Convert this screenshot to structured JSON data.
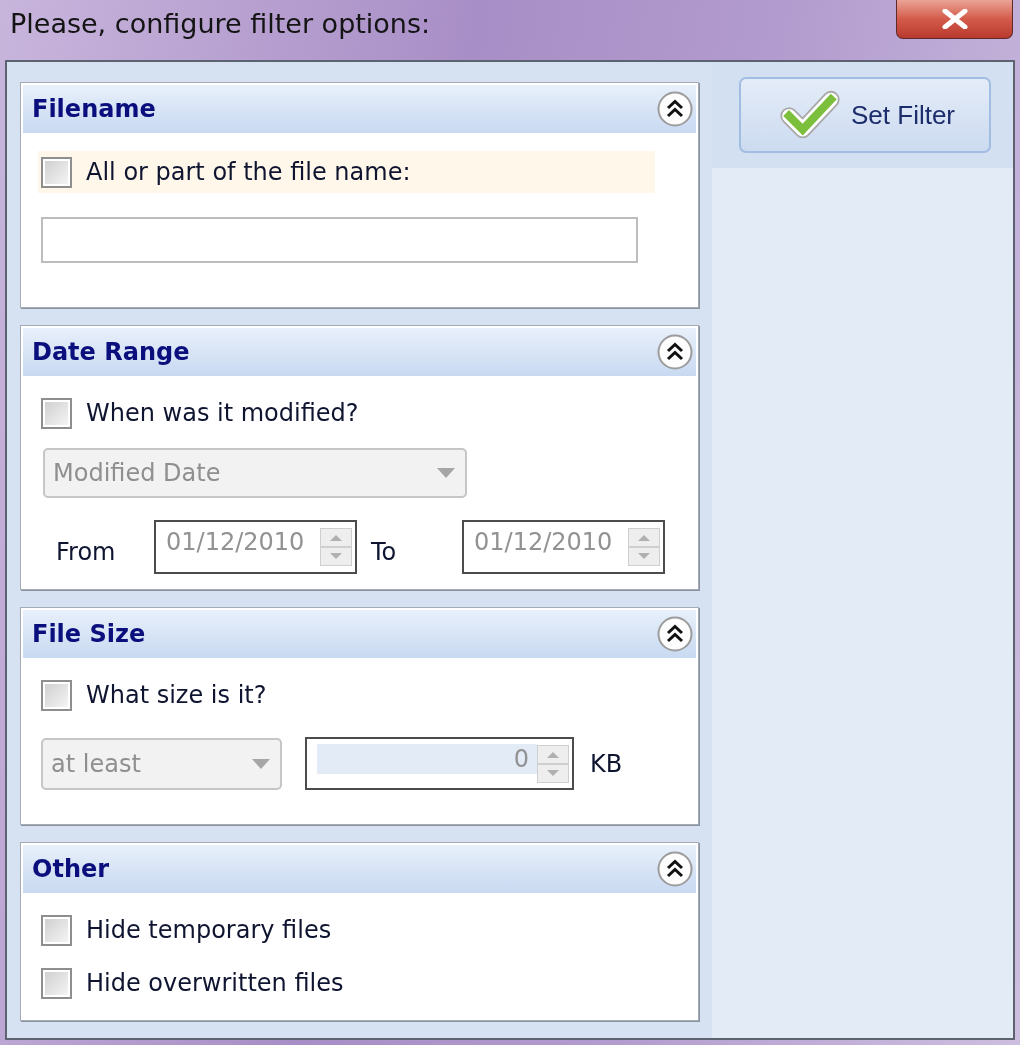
{
  "window": {
    "title": "Please, configure filter options:"
  },
  "sections": [
    {
      "title": "Filename",
      "expanded": true,
      "rows": [
        {
          "kind": "checkbox",
          "label": "All or part of the file name:",
          "checked": false,
          "focused": true
        },
        {
          "kind": "text_field"
        }
      ]
    },
    {
      "title": "Date Range",
      "expanded": true,
      "rows": [
        {
          "kind": "checkbox",
          "label": "When was it modified?",
          "checked": false,
          "focused": false
        },
        {
          "kind": "dropdown",
          "value": "Modified Date",
          "disabled": true
        },
        {
          "kind": "date_range",
          "from_label": "From",
          "from_value": "01/12/2010",
          "to_label": "To",
          "to_value": "01/12/2010",
          "disabled": true
        }
      ]
    },
    {
      "title": "File Size",
      "expanded": true,
      "rows": [
        {
          "kind": "checkbox",
          "label": "What size is it?",
          "checked": false,
          "focused": false
        },
        {
          "kind": "size",
          "comparison": "at least",
          "amount": "0",
          "unit": "KB",
          "disabled": true
        }
      ]
    },
    {
      "title": "Other",
      "expanded": true,
      "rows": [
        {
          "kind": "checkbox",
          "label": "Hide temporary files",
          "checked": false,
          "focused": false
        },
        {
          "kind": "checkbox",
          "label": "Hide overwritten files",
          "checked": false,
          "focused": false
        }
      ]
    }
  ],
  "set_filter_button": {
    "label": "Set Filter"
  }
}
